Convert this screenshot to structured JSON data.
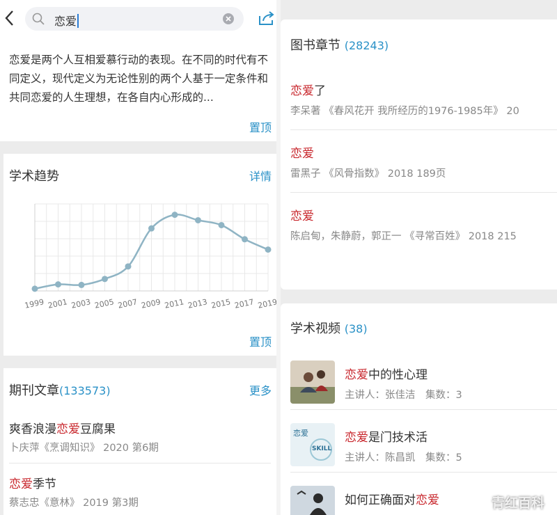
{
  "search": {
    "query": "恋爱"
  },
  "intro": {
    "text": "恋爱是两个人互相爱慕行动的表现。在不同的时代有不同定义，现代定义为无论性别的两个人基于一定条件和共同恋爱的人生理想，在各自内心形成的...",
    "top_link": "置顶"
  },
  "trend": {
    "title": "学术趋势",
    "detail_link": "详情",
    "top_link": "置顶"
  },
  "chart_data": {
    "type": "line",
    "x": [
      1999,
      2000,
      2001,
      2002,
      2003,
      2004,
      2005,
      2006,
      2007,
      2008,
      2009,
      2010,
      2011,
      2012,
      2013,
      2014,
      2015,
      2016,
      2017,
      2018,
      2019
    ],
    "tick_labels": [
      "1999",
      "2001",
      "2003",
      "2005",
      "2007",
      "2009",
      "2011",
      "2013",
      "2015",
      "2017",
      "2019"
    ],
    "points": [
      [
        1999,
        4
      ],
      [
        2001,
        12
      ],
      [
        2003,
        11
      ],
      [
        2005,
        22
      ],
      [
        2007,
        45
      ],
      [
        2009,
        115
      ],
      [
        2011,
        140
      ],
      [
        2013,
        130
      ],
      [
        2015,
        121
      ],
      [
        2017,
        95
      ],
      [
        2019,
        76
      ]
    ],
    "ylim": [
      0,
      160
    ],
    "grid": true,
    "color": "#8fb4c4"
  },
  "journal": {
    "title": "期刊文章",
    "count": "(133573)",
    "more_link": "更多",
    "items": [
      {
        "pre": "爽香浪漫",
        "hl": "恋爱",
        "post": "豆腐果",
        "meta": "卜庆萍《烹调知识》 2020 第6期"
      },
      {
        "pre": "",
        "hl": "恋爱",
        "post": "季节",
        "meta": "蔡志忠《意林》 2019 第3期"
      }
    ]
  },
  "books": {
    "title": "图书章节",
    "count": "(28243)",
    "items": [
      {
        "hl": "恋爱",
        "post": "了",
        "meta": "李呆著 《春风花开 我所经历的1976-1985年》 20"
      },
      {
        "hl": "恋爱",
        "post": "",
        "meta": "雷黑子 《风骨指数》 2018 189页"
      },
      {
        "hl": "恋爱",
        "post": "",
        "meta": "陈启甸，朱静蔚，郭正一 《寻常百姓》 2018 215"
      }
    ]
  },
  "videos": {
    "title": "学术视频",
    "count": "(38)",
    "items": [
      {
        "pre": "",
        "hl": "恋爱",
        "post": "中的性心理",
        "meta": "主讲人：张佳洁　集数：3"
      },
      {
        "pre": "",
        "hl": "恋爱",
        "post": "是门技术活",
        "meta": "主讲人：陈昌凯　集数：5",
        "thumb_text": "恋爱",
        "thumb_sub": "SKILL"
      },
      {
        "pre": "如何正确面对",
        "hl": "恋爱",
        "post": "",
        "meta": ""
      }
    ]
  },
  "watermark": "青红百科",
  "colors": {
    "accent": "#2a91c7",
    "highlight": "#c8262c"
  }
}
